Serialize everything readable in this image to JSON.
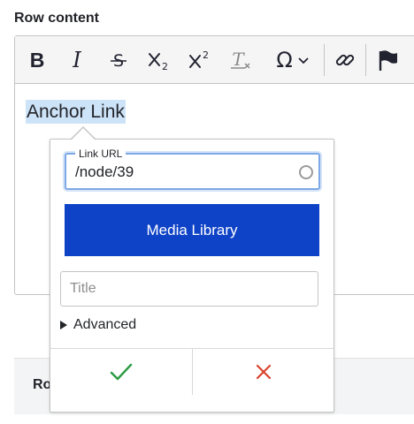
{
  "field": {
    "label": "Row content"
  },
  "toolbar": {
    "buttons": [
      {
        "name": "bold",
        "glyph": "B"
      },
      {
        "name": "italic",
        "glyph": "I"
      },
      {
        "name": "strikethrough",
        "icon": "strikethrough-icon"
      },
      {
        "name": "subscript",
        "icon": "subscript-icon"
      },
      {
        "name": "superscript",
        "icon": "superscript-icon"
      },
      {
        "name": "remove-format",
        "icon": "remove-format-icon"
      },
      {
        "name": "special-characters",
        "glyph": "Ω",
        "icon": "chevron-down-icon"
      },
      {
        "name": "link",
        "icon": "link-icon"
      },
      {
        "name": "anchor",
        "icon": "flag-icon"
      }
    ]
  },
  "content": {
    "text": "Anchor Link"
  },
  "link_balloon": {
    "url_label": "Link URL",
    "url_value": "/node/39",
    "media_button": "Media Library",
    "title_placeholder": "Title",
    "advanced_label": "Advanced",
    "save_icon": "check-icon",
    "cancel_icon": "close-icon"
  },
  "row_bar": {
    "label": "Ro"
  },
  "colors": {
    "accent": "#0f43c7",
    "selection": "#cde3f8",
    "save": "#2b9b43",
    "cancel": "#d9432b"
  }
}
